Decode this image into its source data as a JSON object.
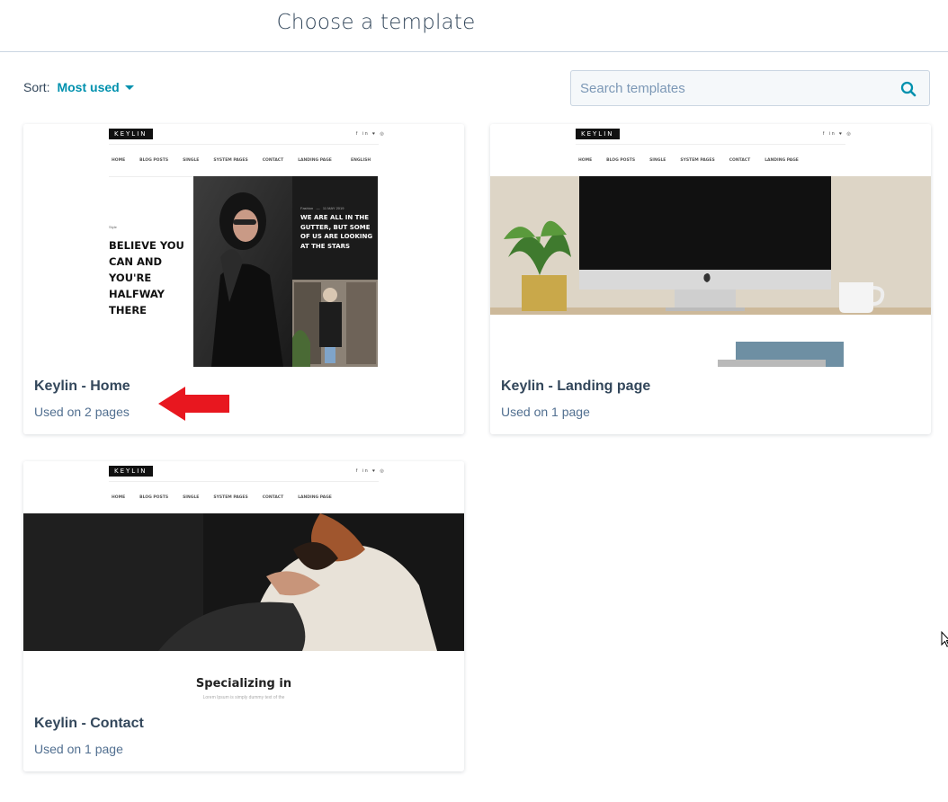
{
  "header": {
    "title": "Choose a template"
  },
  "sort": {
    "label": "Sort:",
    "value": "Most used"
  },
  "search": {
    "placeholder": "Search templates"
  },
  "templates": [
    {
      "name": "Keylin - Home",
      "usage": "Used on 2 pages",
      "preview": {
        "logo": "KEYLIN",
        "nav": [
          "HOME",
          "BLOG POSTS",
          "SINGLE",
          "SYSTEM PAGES",
          "CONTACT",
          "LANDING PAGE"
        ],
        "lang": "ENGLISH",
        "tag": "Style",
        "headline": "BELIEVE YOU CAN AND YOU'RE HALFWAY THERE",
        "meta": [
          "Fashion",
          "11 MAY 2019"
        ],
        "quote": "WE ARE ALL IN THE GUTTER, BUT SOME OF US ARE LOOKING AT THE STARS"
      }
    },
    {
      "name": "Keylin - Landing page",
      "usage": "Used on 1 page",
      "preview": {
        "logo": "KEYLIN",
        "nav": [
          "HOME",
          "BLOG POSTS",
          "SINGLE",
          "SYSTEM PAGES",
          "CONTACT",
          "LANDING PAGE"
        ]
      }
    },
    {
      "name": "Keylin - Contact",
      "usage": "Used on 1 page",
      "preview": {
        "logo": "KEYLIN",
        "nav": [
          "HOME",
          "BLOG POSTS",
          "SINGLE",
          "SYSTEM PAGES",
          "CONTACT",
          "LANDING PAGE"
        ],
        "heading": "Specializing in",
        "subtext": "Lorem Ipsum is simply dummy text of the"
      }
    }
  ],
  "colors": {
    "accent": "#0091ae",
    "text": "#33475b",
    "arrow": "#e8171f"
  }
}
